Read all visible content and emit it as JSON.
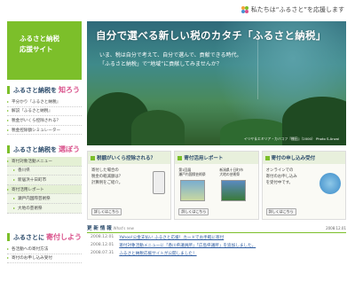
{
  "tagline": "私たちは“ふるさと”を応援します",
  "logo": {
    "line1": "ふるさと納税",
    "line2": "応援サイト"
  },
  "side1": {
    "prefix": "ふるさと納税を",
    "emph": "知ろう",
    "items": [
      "平分かり『ふるさと納税』",
      "解説『ふるさと納税』",
      "税金がいくら控除される？",
      "税金控除額シミュレーター"
    ]
  },
  "side2": {
    "prefix": "ふるさと納税を",
    "emph": "選ぼう",
    "items": [
      "寄付対象活動メニュー",
      "香川県",
      "新居浜十日町市",
      "寄付活用レポート",
      "瀬戸内国際芸術祭",
      "大地の芸術祭"
    ]
  },
  "side3": {
    "prefix": "ふるさとに",
    "emph": "寄付しよう",
    "items": [
      "各活動への寄付方法",
      "寄付のお申し込み受付"
    ]
  },
  "hero": {
    "title": "自分で選べる新しい税のカタチ「ふるさと納税」",
    "sub1": "いま、税は自分で考えて、自分で選んで、貢献できる時代。",
    "sub2": "「ふるさと納税」で“地域”に貢献してみませんか？",
    "caption": "イリヤ＆エミリア・カバコフ『棚田』（2000） Photo S.Anzai"
  },
  "cards": [
    {
      "title": "税額がいくら控除される？",
      "text": [
        "寄付した場合の",
        "税金の軽減額は？",
        "計算例をご紹介。"
      ],
      "btn": "詳しくはこちら"
    },
    {
      "title": "寄付活用レポート",
      "a": "第1回展",
      "a2": "瀬戸内国際芸術祭",
      "b": "新潟県十日町市",
      "b2": "大地の芸術祭",
      "btn": "詳しくはこちら"
    },
    {
      "title": "寄付の申し込み受付",
      "text": [
        "オンラインでの",
        "寄付のお申し込み",
        "を受付中です。"
      ],
      "btn": "詳しくはこちら"
    }
  ],
  "news": {
    "title": "更 新 情 報",
    "new": "What's new",
    "date": "2008.12.01",
    "items": [
      {
        "d": "2008.12.01",
        "t": "Yahoo!公金支払い ふるさと応援！カードでお手軽に寄付"
      },
      {
        "d": "2008.12.01",
        "t": "寄付対象活動メニューに「香川県議員所」「広島県議所」を追加しました。"
      },
      {
        "d": "2008.07.31",
        "t": "ふるさと納税応援サイトが公開しました！"
      }
    ]
  },
  "colors": {
    "accent": "#7cbf2a",
    "pink": "#d9508a",
    "navy": "#2a4a6a"
  }
}
